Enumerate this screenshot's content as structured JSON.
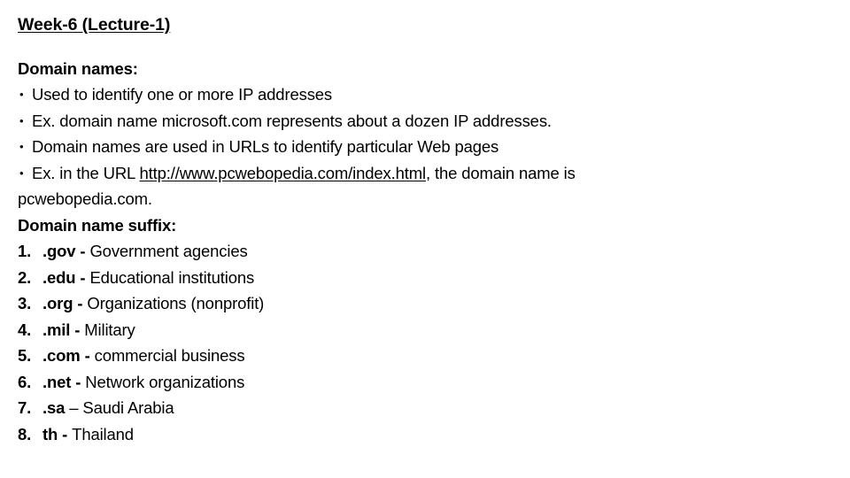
{
  "slide": {
    "title": "Week-6 (Lecture-1)",
    "background_color": "#ffffff",
    "text_color": "#000000",
    "section_one": {
      "heading": "Domain names:",
      "bullet_glyph": "•",
      "bullets": [
        {
          "text": "Used to identify one or more IP addresses"
        },
        {
          "text": "Ex.  domain name microsoft.com represents about a dozen IP addresses."
        },
        {
          "text": "Domain names are used in URLs to identify particular Web pages"
        },
        {
          "prefix": "Ex. in the URL ",
          "url": "http://www.pcwebopedia.com/index.html",
          "suffix": ", the domain name is"
        }
      ],
      "continuation_line": "pcwebopedia.com."
    },
    "section_two": {
      "heading": "Domain name suffix:",
      "items": [
        {
          "number": "1.",
          "token": ".gov",
          "separator": "-",
          "description": "Government agencies"
        },
        {
          "number": "2.",
          "token": ".edu",
          "separator": "-",
          "description": "Educational institutions"
        },
        {
          "number": "3.",
          "token": ".org",
          "separator": "-",
          "description": "Organizations (nonprofit)"
        },
        {
          "number": "4.",
          "token": ".mil",
          "separator": "-",
          "description": "Military"
        },
        {
          "number": "5.",
          "token": ".com",
          "separator": "-",
          "description": "commercial business"
        },
        {
          "number": "6.",
          "token": ".net",
          "separator": "-",
          "description": "Network organizations"
        },
        {
          "number": "7.",
          "token": ".sa",
          "separator": "–",
          "description": "Saudi Arabia"
        },
        {
          "number": "8.",
          "token": "th",
          "separator": "-",
          "description": "Thailand"
        }
      ]
    }
  }
}
